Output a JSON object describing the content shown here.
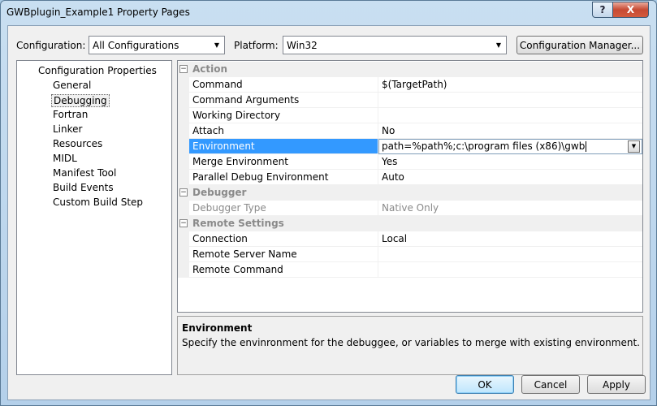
{
  "window": {
    "title": "GWBplugin_Example1 Property Pages",
    "help_label": "?",
    "close_label": "X"
  },
  "config_bar": {
    "configuration_label": "Configuration:",
    "configuration_value": "All Configurations",
    "platform_label": "Platform:",
    "platform_value": "Win32",
    "config_manager_label": "Configuration Manager..."
  },
  "tree": {
    "root": "Configuration Properties",
    "items": [
      "General",
      "Debugging",
      "Fortran",
      "Linker",
      "Resources",
      "MIDL",
      "Manifest Tool",
      "Build Events",
      "Custom Build Step"
    ],
    "selected": "Debugging"
  },
  "grid": {
    "categories": {
      "action": "Action",
      "debugger": "Debugger",
      "remote": "Remote Settings"
    },
    "action_rows": [
      {
        "name": "Command",
        "value": "$(TargetPath)"
      },
      {
        "name": "Command Arguments",
        "value": ""
      },
      {
        "name": "Working Directory",
        "value": ""
      },
      {
        "name": "Attach",
        "value": "No"
      },
      {
        "name": "Environment",
        "value": "path=%path%;c:\\program files (x86)\\gwb"
      },
      {
        "name": "Merge Environment",
        "value": "Yes"
      },
      {
        "name": "Parallel Debug Environment",
        "value": "Auto"
      }
    ],
    "debugger_rows": [
      {
        "name": "Debugger Type",
        "value": "Native Only"
      }
    ],
    "remote_rows": [
      {
        "name": "Connection",
        "value": "Local"
      },
      {
        "name": "Remote Server Name",
        "value": ""
      },
      {
        "name": "Remote Command",
        "value": ""
      }
    ],
    "collapse_symbol": "−"
  },
  "description": {
    "title": "Environment",
    "text": "Specify the envinronment for the debuggee, or variables to merge with existing environment."
  },
  "buttons": {
    "ok": "OK",
    "cancel": "Cancel",
    "apply": "Apply"
  }
}
